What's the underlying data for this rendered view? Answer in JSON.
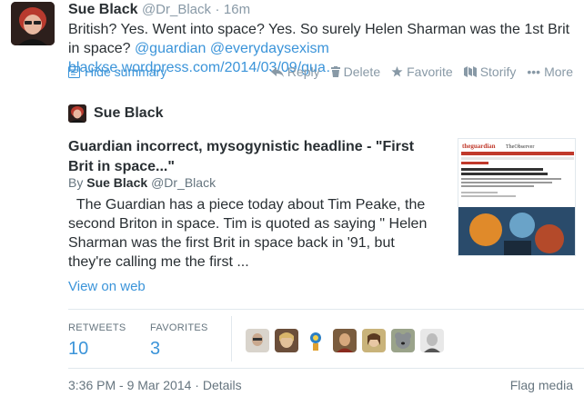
{
  "tweet": {
    "author_name": "Sue Black",
    "author_handle": "@Dr_Black",
    "time_ago": "16m",
    "text_plain": "British? Yes. Went into space? Yes. So surely Helen Sharman was the 1st Brit in space? ",
    "text_link1": "@guardian",
    "text_link2": "@everydaysexism",
    "text_link3": "blackse.wordpress.com/2014/03/09/gua…"
  },
  "controls": {
    "hide_summary": "Hide summary",
    "reply": "Reply",
    "delete": "Delete",
    "favorite": "Favorite",
    "storify": "Storify",
    "more": "More"
  },
  "card": {
    "author": "Sue Black",
    "title": "Guardian incorrect, mysogynistic headline - \"First Brit in space...\"",
    "by_prefix": "By",
    "by_name": "Sue Black",
    "by_handle": "@Dr_Black",
    "description": "The Guardian has a piece today about Tim Peake, the second Briton in space. Tim is quoted as saying \" Helen Sharman was the first Brit in space back in '91, but they're calling me the first ...",
    "view_on_web": "View on web"
  },
  "stats": {
    "retweets_label": "RETWEETS",
    "retweets_value": "10",
    "favorites_label": "FAVORITES",
    "favorites_value": "3"
  },
  "footer": {
    "timestamp": "3:36 PM - 9 Mar 2014 · Details",
    "flag": "Flag media"
  },
  "colors": {
    "link": "#3b94d9",
    "muted": "#8899a6",
    "text": "#292f33"
  }
}
